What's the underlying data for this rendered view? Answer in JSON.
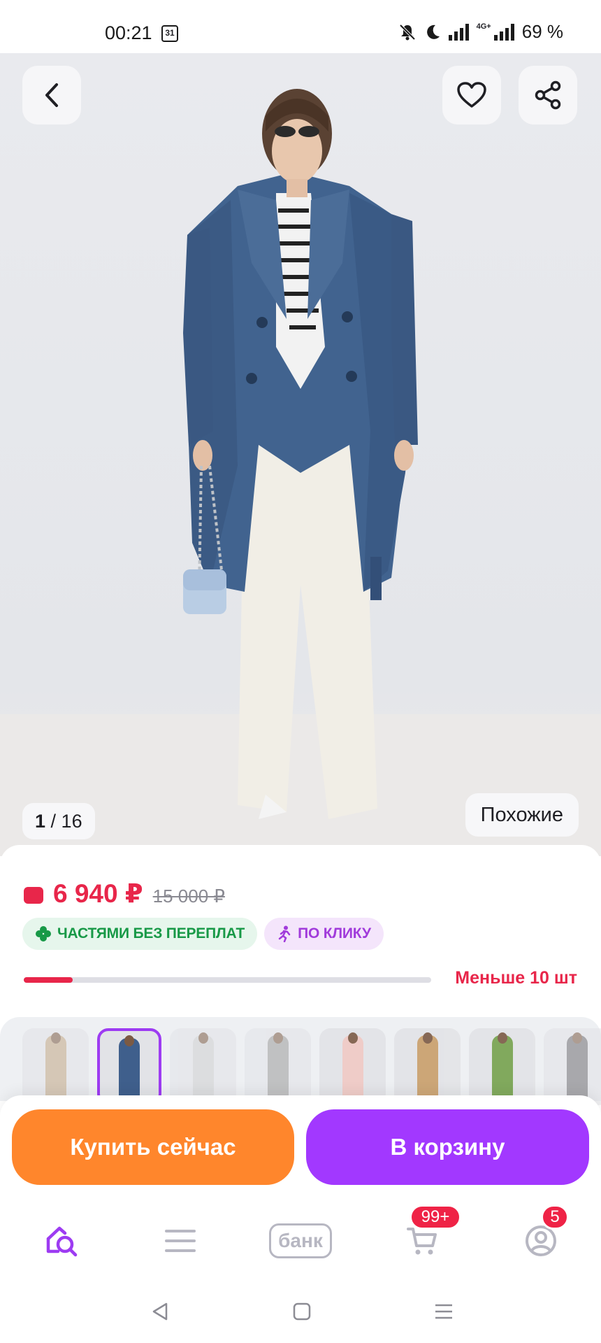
{
  "status_bar": {
    "time": "00:21",
    "calendar_day": "31",
    "network": "4G+",
    "battery": "69 %"
  },
  "gallery": {
    "current": "1",
    "total": "/ 16",
    "similar_label": "Похожие"
  },
  "product": {
    "price": "6 940 ₽",
    "old_price": "15 000 ₽",
    "badges": [
      {
        "label": "ЧАСТЯМИ БЕЗ ПЕРЕПЛАТ",
        "color": "#189947"
      },
      {
        "label": "ПО КЛИКУ",
        "color": "#a13bdb"
      }
    ],
    "stock_text": "Меньше 10 шт",
    "stock_fraction": 0.12
  },
  "thumbnails": [
    {
      "coat": "beige",
      "active": false
    },
    {
      "coat": "navy",
      "active": true
    },
    {
      "coat": "light-grey",
      "active": false
    },
    {
      "coat": "grey",
      "active": false
    },
    {
      "coat": "pink",
      "active": false
    },
    {
      "coat": "camel",
      "active": false
    },
    {
      "coat": "olive",
      "active": false
    },
    {
      "coat": "dark-grey",
      "active": false
    }
  ],
  "actions": {
    "buy_now": "Купить сейчас",
    "add_to_cart": "В корзину"
  },
  "tabbar": {
    "bank_label": "банк",
    "cart_badge": "99+",
    "profile_badge": "5"
  },
  "colors": {
    "accent_red": "#e8264a",
    "buy_orange": "#ff862c",
    "cart_purple": "#a238ff",
    "active_thumb_border": "#9d3bf2"
  }
}
